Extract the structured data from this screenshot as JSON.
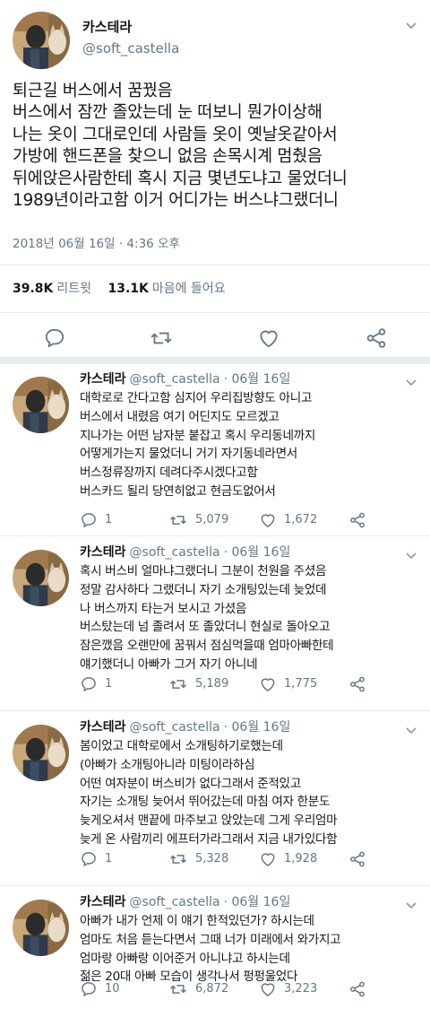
{
  "main_tweet": {
    "author_name": "카스테라",
    "author_handle": "@soft_castella",
    "lines": [
      "퇴근길 버스에서 꿈꿨음",
      "버스에서 잠깐 졸았는데 눈 떠보니 뭔가이상해",
      "나는 옷이 그대로인데 사람들 옷이 옛날옷같아서",
      "가방에 핸드폰을 찾으니 없음 손목시계 멈췄음",
      "뒤에앉은사람한테 혹시 지금 몇년도냐고 물었더니",
      "1989년이라고함 이거 어디가는 버스냐그랬더니"
    ],
    "timestamp": "2018년 06월 16일 · 4:36 오후",
    "retweet_count": "39.8K",
    "retweet_label": "리트윗",
    "like_count": "13.1K",
    "like_label": "마음에 들어요"
  },
  "icons": {
    "reply": "speech-bubble-icon",
    "retweet": "retweet-arrows-icon",
    "like": "heart-icon",
    "share": "share-nodes-icon",
    "menu": "chevron-down-icon"
  },
  "colors": {
    "text": "#14171a",
    "secondary": "#657786",
    "divider": "#e6ecf0"
  },
  "replies": [
    {
      "name": "카스테라",
      "handle": "@soft_castella",
      "date": "· 06월 16일",
      "lines": [
        "대학로로 간다고함 심지어 우리집방향도 아니고",
        "버스에서 내렸음 여기 어딘지도 모르겠고",
        "지나가는 어떤 남자분 붙잡고 혹시 우리동네까지",
        "어떻게가는지 물었더니 거기 자기동네라면서",
        "버스정류장까지 데려다주시겠다고함",
        "버스카드 될리 당연히없고 현금도없어서"
      ],
      "replies": "1",
      "retweets": "5,079",
      "likes": "1,672"
    },
    {
      "name": "카스테라",
      "handle": "@soft_castella",
      "date": "· 06월 16일",
      "lines": [
        "혹시 버스비 얼마냐그랬더니 그분이 천원을 주셨음",
        "정말 감사하다 그랬더니 자기 소개팅있는데 늦었데",
        "나 버스까지 타는거 보시고 가셨음",
        "버스탔는데 넘 졸려서 또 졸았더니 현실로 돌아오고",
        "잠은깼음 오랜만에 꿈꿔서 점심먹을때 엄마아빠한테",
        "얘기했더니 아빠가 그거 자기 아니네"
      ],
      "replies": "1",
      "retweets": "5,189",
      "likes": "1,775"
    },
    {
      "name": "카스테라",
      "handle": "@soft_castella",
      "date": "· 06월 16일",
      "lines": [
        "봄이었고 대학로에서 소개팅하기로했는데",
        "(아빠가 소개팅아니라 미팅이라하심",
        "어떤 여자분이 버스비가 없다그래서 준적있고",
        "자기는 소개팅 늦어서 뛰어갔는데 마침 여자 한분도",
        "늦게오셔서 맨끝에 마주보고 앉았는데 그게 우리엄마",
        "늦게 온 사람끼리 에프터가라그래서 지금 내가있다함"
      ],
      "replies": "1",
      "retweets": "5,328",
      "likes": "1,928"
    },
    {
      "name": "카스테라",
      "handle": "@soft_castella",
      "date": "· 06월 16일",
      "lines": [
        "아빠가 내가 언제 이 얘기 한적있던가? 하시는데",
        "엄마도 처음 듣는다면서 그때 너가 미래에서 와가지고",
        "엄마랑 아빠랑 이어준거 아니냐고 하시는데",
        "젊은 20대 아빠 모습이 생각나서 펑펑울었다"
      ],
      "replies": "10",
      "retweets": "6,872",
      "likes": "3,223"
    }
  ]
}
